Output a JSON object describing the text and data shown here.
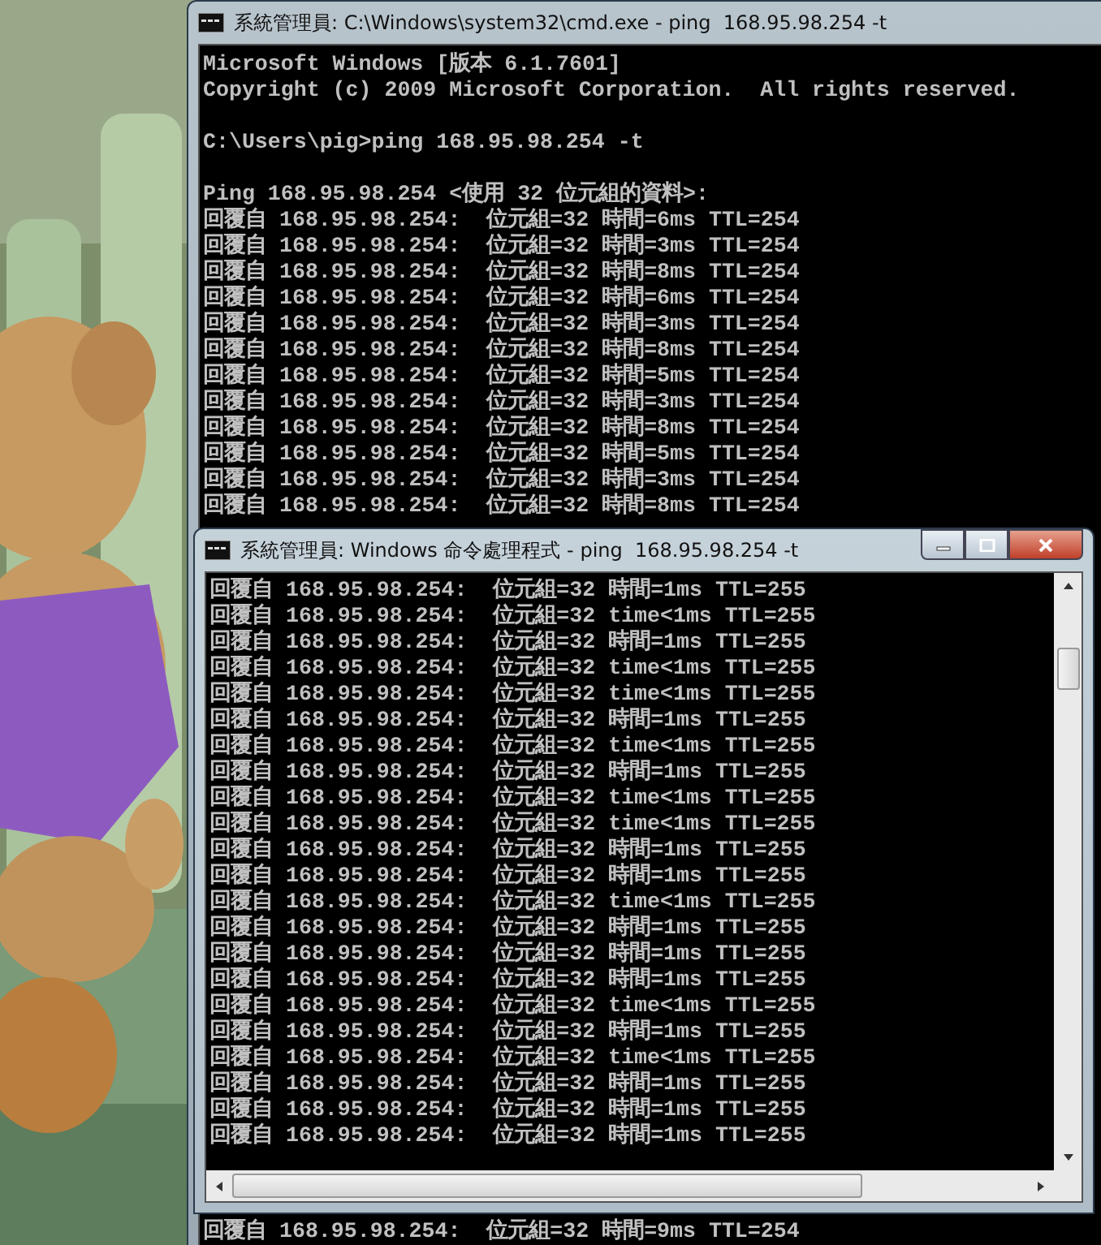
{
  "windows": [
    {
      "title": "系統管理員: C:\\Windows\\system32\\cmd.exe - ping  168.95.98.254 -t",
      "active": false,
      "blocks": [
        [
          "Microsoft Windows [版本 6.1.7601]",
          "Copyright (c) 2009 Microsoft Corporation.  All rights reserved."
        ],
        [
          "C:\\Users\\pig>ping 168.95.98.254 -t"
        ],
        [
          "Ping 168.95.98.254 <使用 32 位元組的資料>:",
          "回覆自 168.95.98.254:  位元組=32 時間=6ms TTL=254",
          "回覆自 168.95.98.254:  位元組=32 時間=3ms TTL=254",
          "回覆自 168.95.98.254:  位元組=32 時間=8ms TTL=254",
          "回覆自 168.95.98.254:  位元組=32 時間=6ms TTL=254",
          "回覆自 168.95.98.254:  位元組=32 時間=3ms TTL=254",
          "回覆自 168.95.98.254:  位元組=32 時間=8ms TTL=254",
          "回覆自 168.95.98.254:  位元組=32 時間=5ms TTL=254",
          "回覆自 168.95.98.254:  位元組=32 時間=3ms TTL=254",
          "回覆自 168.95.98.254:  位元組=32 時間=8ms TTL=254",
          "回覆自 168.95.98.254:  位元組=32 時間=5ms TTL=254",
          "回覆自 168.95.98.254:  位元組=32 時間=3ms TTL=254",
          "回覆自 168.95.98.254:  位元組=32 時間=8ms TTL=254"
        ]
      ],
      "lines_below": [
        "回覆自 168.95.98.254:  位元組=32 時間=9ms TTL=254"
      ]
    },
    {
      "title": "系統管理員: Windows 命令處理程式 - ping  168.95.98.254 -t",
      "active": true,
      "blocks": [
        [
          "回覆自 168.95.98.254:  位元組=32 時間=1ms TTL=255",
          "回覆自 168.95.98.254:  位元組=32 time<1ms TTL=255",
          "回覆自 168.95.98.254:  位元組=32 時間=1ms TTL=255",
          "回覆自 168.95.98.254:  位元組=32 time<1ms TTL=255",
          "回覆自 168.95.98.254:  位元組=32 time<1ms TTL=255",
          "回覆自 168.95.98.254:  位元組=32 時間=1ms TTL=255",
          "回覆自 168.95.98.254:  位元組=32 time<1ms TTL=255",
          "回覆自 168.95.98.254:  位元組=32 時間=1ms TTL=255",
          "回覆自 168.95.98.254:  位元組=32 time<1ms TTL=255",
          "回覆自 168.95.98.254:  位元組=32 time<1ms TTL=255",
          "回覆自 168.95.98.254:  位元組=32 時間=1ms TTL=255",
          "回覆自 168.95.98.254:  位元組=32 時間=1ms TTL=255",
          "回覆自 168.95.98.254:  位元組=32 time<1ms TTL=255",
          "回覆自 168.95.98.254:  位元組=32 時間=1ms TTL=255",
          "回覆自 168.95.98.254:  位元組=32 時間=1ms TTL=255",
          "回覆自 168.95.98.254:  位元組=32 時間=1ms TTL=255",
          "回覆自 168.95.98.254:  位元組=32 time<1ms TTL=255",
          "回覆自 168.95.98.254:  位元組=32 時間=1ms TTL=255",
          "回覆自 168.95.98.254:  位元組=32 time<1ms TTL=255",
          "回覆自 168.95.98.254:  位元組=32 時間=1ms TTL=255",
          "回覆自 168.95.98.254:  位元組=32 時間=1ms TTL=255",
          "回覆自 168.95.98.254:  位元組=32 時間=1ms TTL=255"
        ]
      ]
    }
  ]
}
